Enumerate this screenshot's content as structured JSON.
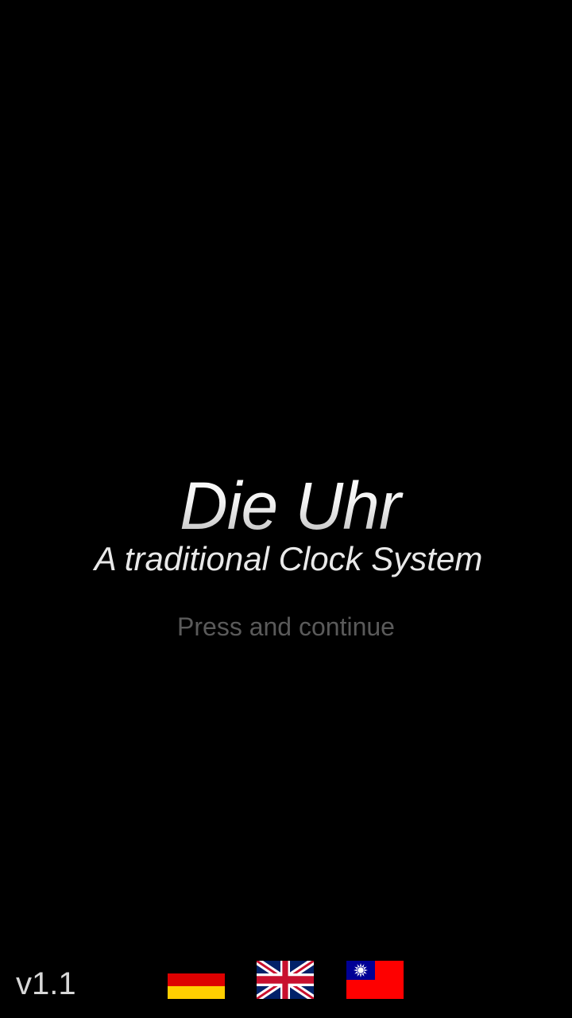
{
  "app": {
    "title": "Die Uhr",
    "subtitle": "A traditional Clock System",
    "prompt": "Press and continue",
    "version": "v1.1"
  },
  "languages": [
    {
      "code": "de",
      "icon": "german-flag-icon"
    },
    {
      "code": "en",
      "icon": "uk-flag-icon"
    },
    {
      "code": "zh-TW",
      "icon": "taiwan-flag-icon"
    }
  ],
  "colors": {
    "background": "#000000",
    "title": "#f2f2f2",
    "subtitle": "#e9e9e9",
    "prompt": "#5a5a5a",
    "version": "#d7d7d7"
  }
}
